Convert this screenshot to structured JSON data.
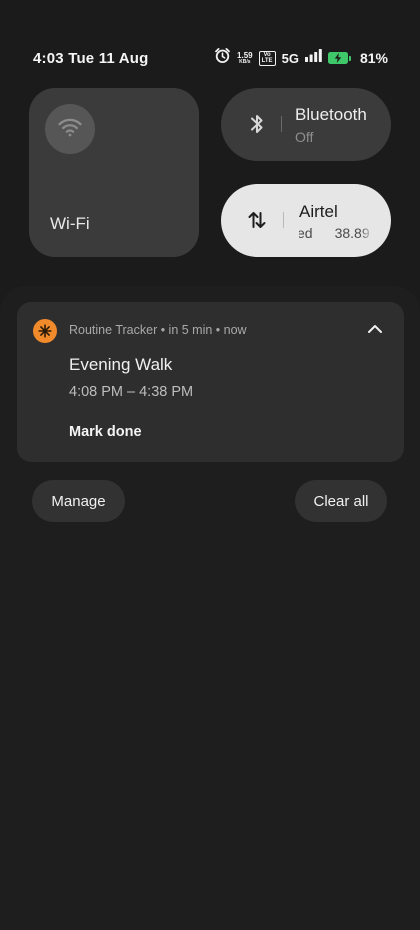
{
  "status_bar": {
    "time_date": "4:03  Tue 11 Aug",
    "alarm_icon": "alarm-clock-icon",
    "net_speed_value": "1.59",
    "net_speed_unit": "KB/s",
    "volte_top": "Vo",
    "volte_bottom": "LTE",
    "network_type": "5G",
    "signal_icon": "signal-bars-icon",
    "battery_icon": "battery-charging-icon",
    "battery_level": 0.81,
    "battery_percent": "81%",
    "battery_color": "#3ec86a"
  },
  "quick_settings": {
    "wifi": {
      "label": "Wi-Fi",
      "icon": "wifi-icon",
      "active": false
    },
    "bluetooth": {
      "label": "Bluetooth",
      "status": "Off",
      "icon": "bluetooth-icon",
      "active": false
    },
    "mobile_data": {
      "label": "Airtel",
      "status_text": "ed",
      "speed_text": "38.89",
      "icon": "data-transfer-icon",
      "active": true
    }
  },
  "notification": {
    "app_icon": "routine-tracker-icon",
    "app_icon_color": "#f18a2b",
    "header": "Routine Tracker • in 5 min • now",
    "title": "Evening Walk",
    "time_range": "4:08 PM – 4:38 PM",
    "action_label": "Mark done",
    "collapse_icon": "chevron-up-icon"
  },
  "shade_actions": {
    "manage_label": "Manage",
    "clear_all_label": "Clear all"
  }
}
